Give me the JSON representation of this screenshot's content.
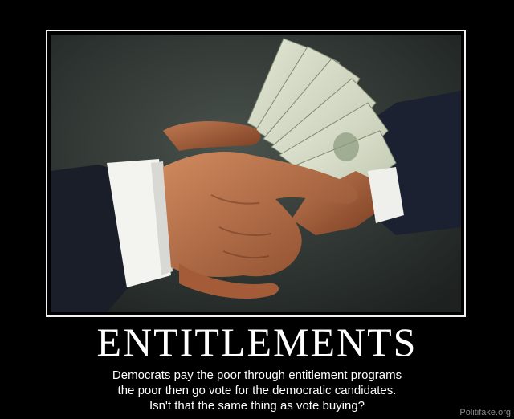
{
  "poster": {
    "title": "ENTITLEMENTS",
    "caption_lines": [
      "Democrats pay the poor through entitlement programs",
      "the poor then go vote for the democratic candidates.",
      "Isn't that the same thing as vote buying?"
    ],
    "watermark": "Politifake.org"
  },
  "image": {
    "description_icon": "handshake-with-money-icon"
  },
  "colors": {
    "background": "#000000",
    "border": "#f2f2f2",
    "text": "#ffffff",
    "watermark": "#8a8a8a"
  }
}
